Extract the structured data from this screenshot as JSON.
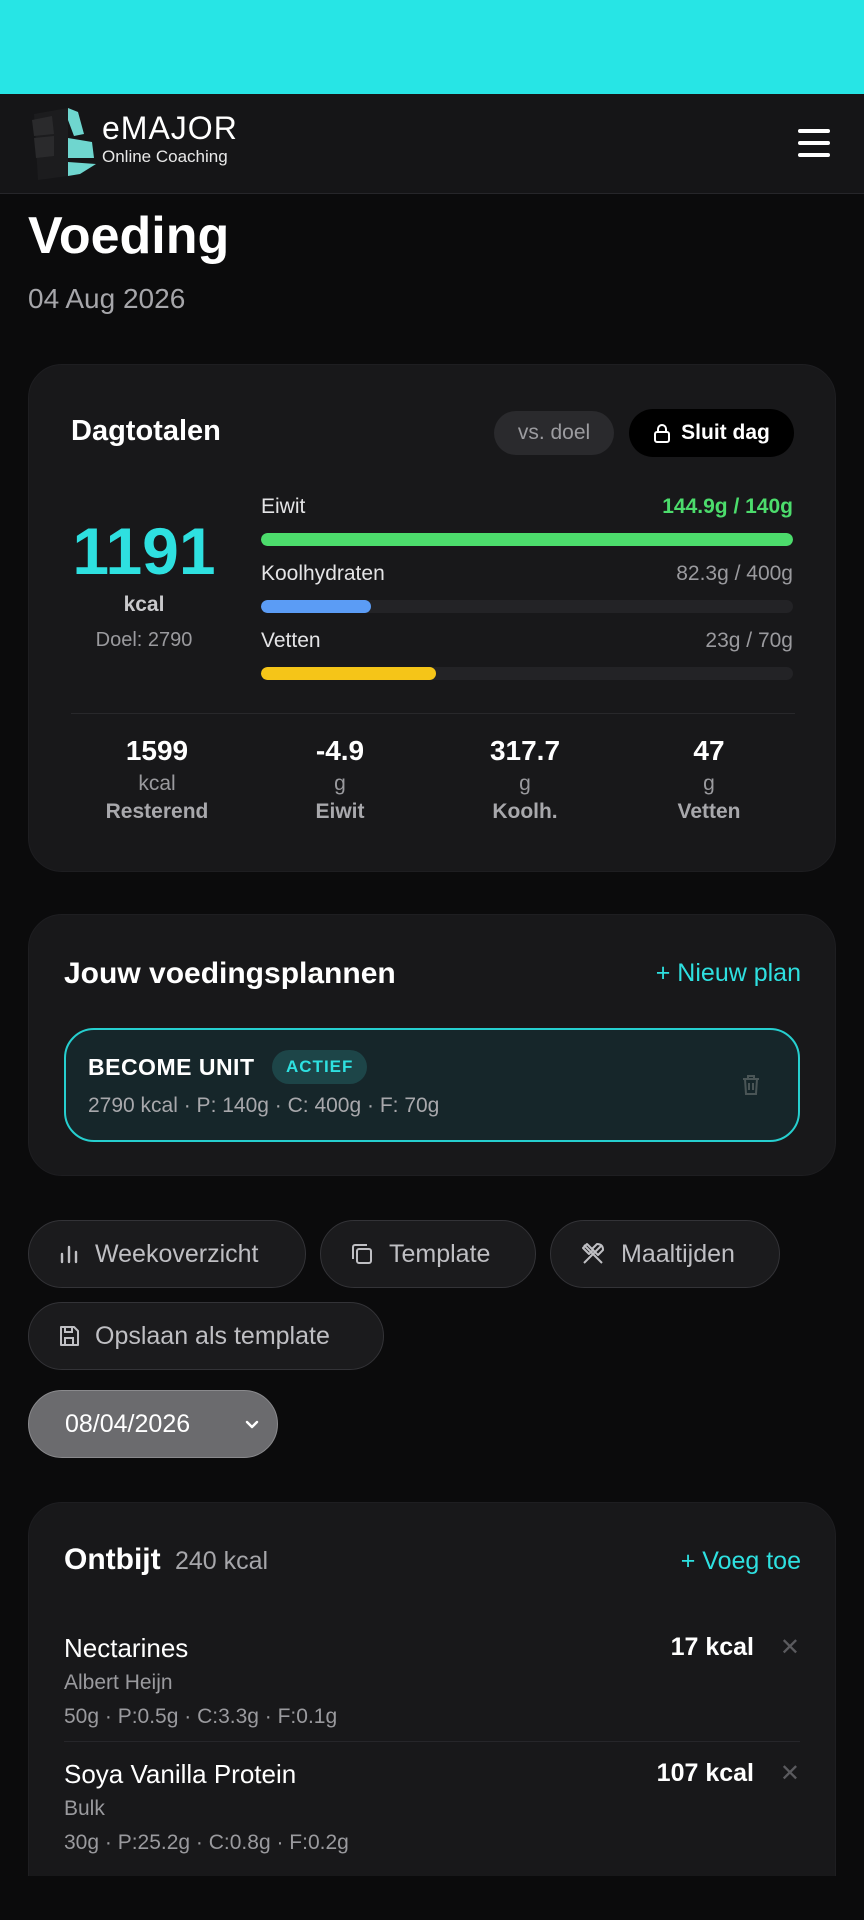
{
  "header": {
    "brand": "eMAJOR",
    "subtitle": "Online Coaching"
  },
  "page": {
    "title": "Voeding",
    "date": "04 Aug 2026"
  },
  "totals": {
    "title": "Dagtotalen",
    "vs_goal_label": "vs. doel",
    "close_day_label": "Sluit dag",
    "kcal": "1191",
    "kcal_unit": "kcal",
    "kcal_goal": "Doel: 2790",
    "macros": [
      {
        "label": "Eiwit",
        "value": "144.9g / 140g",
        "progress": 1.0,
        "color": "#4cdc6c",
        "reached": true
      },
      {
        "label": "Koolhydraten",
        "value": "82.3g / 400g",
        "progress": 0.206,
        "color": "#5b9cf5",
        "reached": false
      },
      {
        "label": "Vetten",
        "value": "23g / 70g",
        "progress": 0.329,
        "color": "#f5c518",
        "reached": false
      }
    ],
    "stats": [
      {
        "value": "1599",
        "unit": "kcal",
        "label": "Resterend"
      },
      {
        "value": "-4.9",
        "unit": "g",
        "label": "Eiwit"
      },
      {
        "value": "317.7",
        "unit": "g",
        "label": "Koolh."
      },
      {
        "value": "47",
        "unit": "g",
        "label": "Vetten"
      }
    ]
  },
  "plans": {
    "title": "Jouw voedingsplannen",
    "new_label": "+ Nieuw plan",
    "items": [
      {
        "name": "BECOME UNIT",
        "badge": "ACTIEF",
        "meta": "2790 kcal · P: 140g · C: 400g · F: 70g"
      }
    ]
  },
  "actions": {
    "week": "Weekoverzicht",
    "template": "Template",
    "meals": "Maaltijden",
    "save_template": "Opslaan als template"
  },
  "date_select": {
    "value": "08/04/2026"
  },
  "meal": {
    "title": "Ontbijt",
    "kcal": "240 kcal",
    "add_label": "+ Voeg toe",
    "items": [
      {
        "name": "Nectarines",
        "brand": "Albert Heijn",
        "macros": "50g · P:0.5g · C:3.3g · F:0.1g",
        "kcal": "17 kcal"
      },
      {
        "name": "Soya Vanilla Protein",
        "brand": "Bulk",
        "macros": "30g · P:25.2g · C:0.8g · F:0.2g",
        "kcal": "107 kcal"
      }
    ]
  },
  "colors": {
    "accent": "#2ee0e0",
    "statusbar": "#27e5e5",
    "background": "#0b0b0c",
    "card": "#18181a"
  }
}
